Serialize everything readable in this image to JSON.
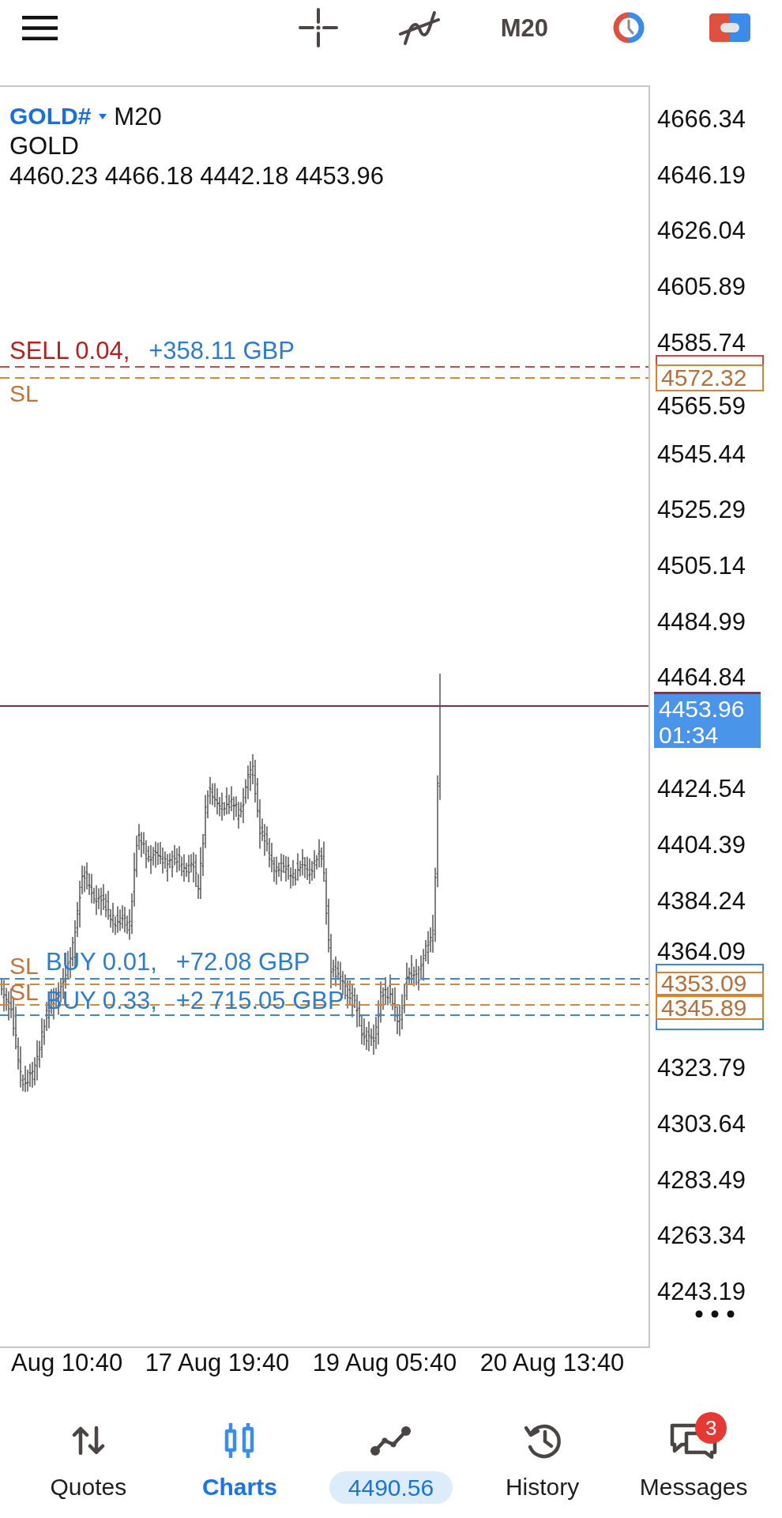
{
  "toolbar": {
    "timeframe": "M20"
  },
  "chart": {
    "symbol": "GOLD#",
    "timeframe": "M20",
    "description": "GOLD",
    "ohlc": "4460.23 4466.18 4442.18 4453.96",
    "trade_lines": [
      {
        "kind": "sell",
        "label": "SELL 0.04,",
        "profit": "+358.11 GBP"
      },
      {
        "kind": "stop_loss",
        "label": "SL",
        "price": "4572.32"
      },
      {
        "kind": "buy",
        "label": "BUY 0.01,",
        "profit": "+72.08 GBP"
      },
      {
        "kind": "stop_loss",
        "label": "SL",
        "price": "4353.09"
      },
      {
        "kind": "stop_loss",
        "label": "SL",
        "price": "4345.89"
      },
      {
        "kind": "buy",
        "label": "BUY 0.33,",
        "profit": "+2 715.05 GBP"
      }
    ],
    "current_price": {
      "price": "4453.96",
      "countdown": "01:34"
    },
    "price_axis": {
      "ticks": [
        "4666.34",
        "4646.19",
        "4626.04",
        "4605.89",
        "4585.74",
        "4565.59",
        "4545.44",
        "4525.29",
        "4505.14",
        "4484.99",
        "4464.84",
        "4424.54",
        "4404.39",
        "4384.24",
        "4364.09",
        "4323.79",
        "4303.64",
        "4283.49",
        "4263.34",
        "4243.19"
      ]
    },
    "time_axis": {
      "ticks": [
        "Aug 10:40",
        "17 Aug 19:40",
        "19 Aug 05:40",
        "20 Aug 13:40"
      ]
    }
  },
  "nav": [
    {
      "kind": "quotes",
      "label": "Quotes",
      "selected": false
    },
    {
      "kind": "charts",
      "label": "Charts",
      "selected": true
    },
    {
      "kind": "trade",
      "value": "4490.56",
      "selected": false
    },
    {
      "kind": "history",
      "label": "History",
      "selected": false
    },
    {
      "kind": "messages",
      "label": "Messages",
      "badge": "3",
      "selected": false
    }
  ]
}
